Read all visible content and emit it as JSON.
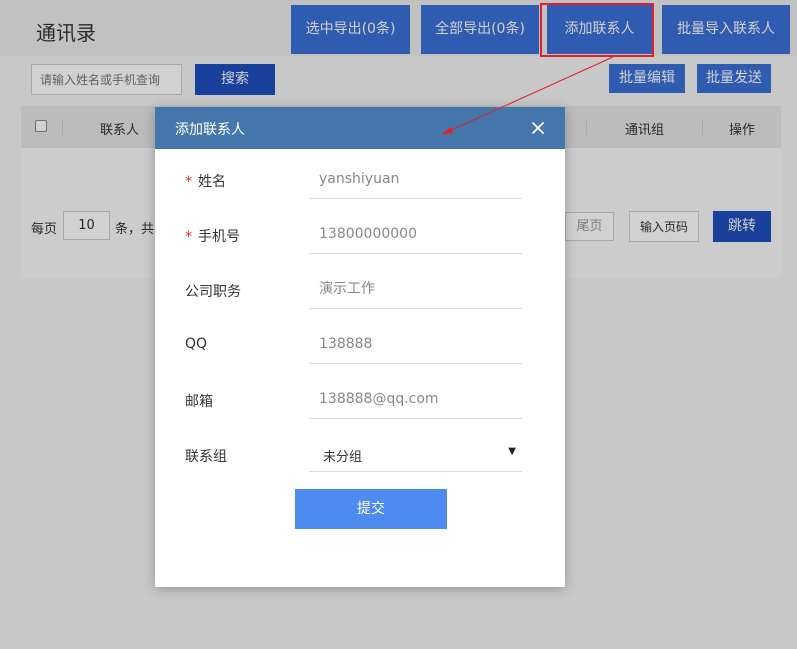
{
  "header": {
    "title": "通讯录",
    "buttons": {
      "export_selected": "选中导出(0条)",
      "export_all": "全部导出(0条)",
      "add_contact": "添加联系人",
      "batch_import": "批量导入联系人"
    }
  },
  "toolbar": {
    "search_placeholder": "请输入姓名或手机查询",
    "search_label": "搜索",
    "batch_edit_label": "批量编辑",
    "batch_send_label": "批量发送"
  },
  "table": {
    "columns": [
      "联系人",
      "通讯组",
      "操作"
    ]
  },
  "pager": {
    "per_page_label": "每页",
    "page_size_value": "10",
    "unit_total_label": "条，共",
    "last_page_label": "尾页",
    "page_input_placeholder": "输入页码",
    "jump_label": "跳转"
  },
  "modal": {
    "title": "添加联系人",
    "required_mark": "*",
    "fields": {
      "name": {
        "label": "姓名",
        "placeholder": "yanshiyuan"
      },
      "phone": {
        "label": "手机号",
        "placeholder": "13800000000"
      },
      "position": {
        "label": "公司职务",
        "placeholder": "演示工作"
      },
      "qq": {
        "label": "QQ",
        "placeholder": "138888"
      },
      "email": {
        "label": "邮箱",
        "placeholder": "138888@qq.com"
      },
      "group": {
        "label": "联系组",
        "value": "未分组"
      }
    },
    "submit_label": "提交"
  },
  "colors": {
    "primary_blue": "#3a6fd8",
    "dark_blue": "#1f4fbd",
    "modal_header": "#4577ac",
    "submit_button": "#4e8bf0",
    "highlight_red": "#e0202a",
    "required_red": "#e2342c"
  },
  "icons": {
    "close": "close-icon",
    "dropdown_caret": "caret-down-icon",
    "annotation_arrow": "arrow-annotation"
  }
}
